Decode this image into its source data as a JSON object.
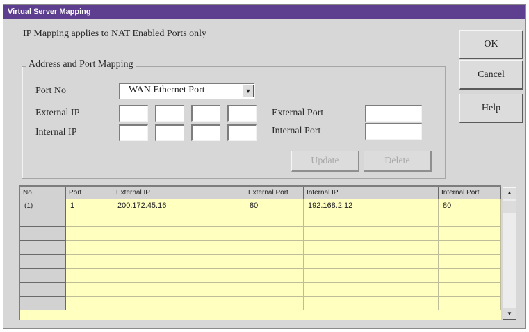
{
  "window": {
    "title": "Virtual Server Mapping"
  },
  "notice": "IP Mapping applies to NAT Enabled Ports only",
  "group": {
    "label": "Address and Port Mapping"
  },
  "form": {
    "port_no_label": "Port No",
    "port_no_value": "WAN Ethernet Port",
    "external_ip_label": "External IP",
    "internal_ip_label": "Internal IP",
    "external_port_label": "External Port",
    "internal_port_label": "Internal Port",
    "external_ip_octets": [
      "",
      "",
      "",
      ""
    ],
    "internal_ip_octets": [
      "",
      "",
      "",
      ""
    ],
    "external_port_value": "",
    "internal_port_value": ""
  },
  "buttons": {
    "ok": "OK",
    "cancel": "Cancel",
    "help": "Help",
    "update": "Update",
    "delete": "Delete"
  },
  "table": {
    "columns": [
      "No.",
      "Port",
      "External IP",
      "External Port",
      "Internal IP",
      "Internal Port"
    ],
    "rows": [
      {
        "no": "(1)",
        "port": "1",
        "external_ip": "200.172.45.16",
        "external_port": "80",
        "internal_ip": "192.168.2.12",
        "internal_port": "80"
      }
    ],
    "empty_row_count": 7
  },
  "colors": {
    "titlebar": "#5e3f8f",
    "dialog_bg": "#d7d7d7",
    "grid_bg": "#ffffc0"
  },
  "icons": {
    "dropdown": "chevron-down-icon",
    "scroll_up": "arrow-up-icon",
    "scroll_down": "arrow-down-icon"
  }
}
